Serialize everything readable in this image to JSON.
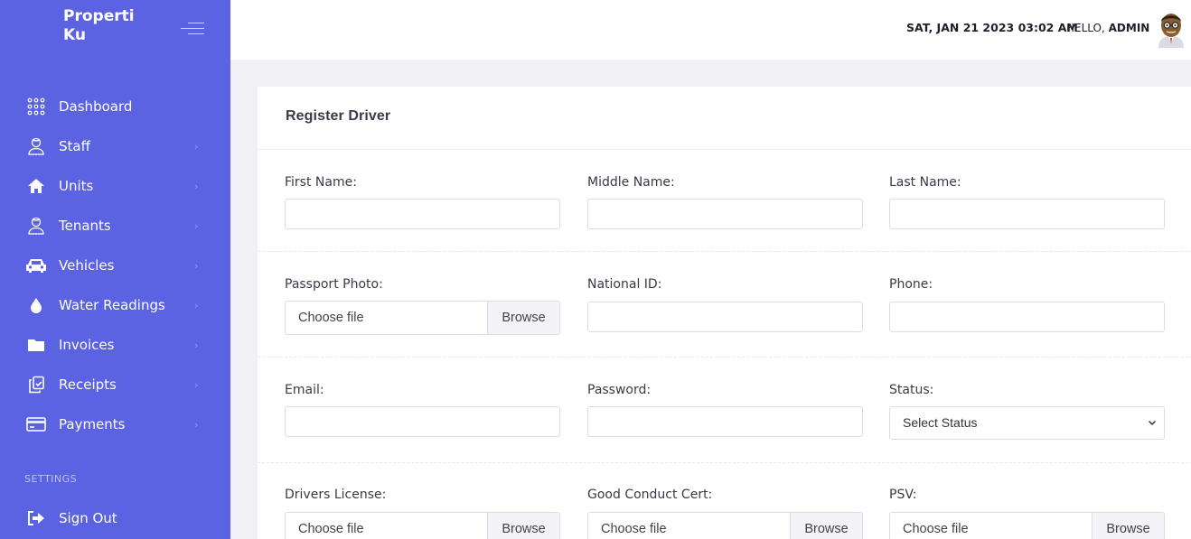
{
  "brand": {
    "line1": "Properti",
    "line2": "Ku"
  },
  "sidebar": {
    "items": [
      {
        "label": "Dashboard",
        "icon": "dots-grid-icon",
        "chevron": false
      },
      {
        "label": "Staff",
        "icon": "user-icon",
        "chevron": true
      },
      {
        "label": "Units",
        "icon": "home-icon",
        "chevron": true
      },
      {
        "label": "Tenants",
        "icon": "user-icon",
        "chevron": true
      },
      {
        "label": "Vehicles",
        "icon": "car-icon",
        "chevron": true
      },
      {
        "label": "Water Readings",
        "icon": "water-drop-icon",
        "chevron": true
      },
      {
        "label": "Invoices",
        "icon": "folder-icon",
        "chevron": true
      },
      {
        "label": "Receipts",
        "icon": "copy-icon",
        "chevron": true
      },
      {
        "label": "Payments",
        "icon": "credit-card-icon",
        "chevron": true
      }
    ],
    "settings_title": "SETTINGS",
    "signout_label": "Sign Out",
    "chevron": "›"
  },
  "header": {
    "datetime": "SAT, JAN 21 2023 03:02 AM",
    "hello": "HELLO,",
    "user": "ADMIN"
  },
  "form": {
    "title": "Register Driver",
    "first_name_label": "First Name:",
    "middle_name_label": "Middle Name:",
    "last_name_label": "Last Name:",
    "passport_label": "Passport Photo:",
    "national_id_label": "National ID:",
    "phone_label": "Phone:",
    "email_label": "Email:",
    "password_label": "Password:",
    "status_label": "Status:",
    "status_selected": "Select Status",
    "license_label": "Drivers License:",
    "good_conduct_label": "Good Conduct Cert:",
    "psv_label": "PSV:",
    "choose_file": "Choose file",
    "browse": "Browse"
  },
  "colors": {
    "sidebar": "#5b63e3",
    "background": "#f0f0f5"
  }
}
